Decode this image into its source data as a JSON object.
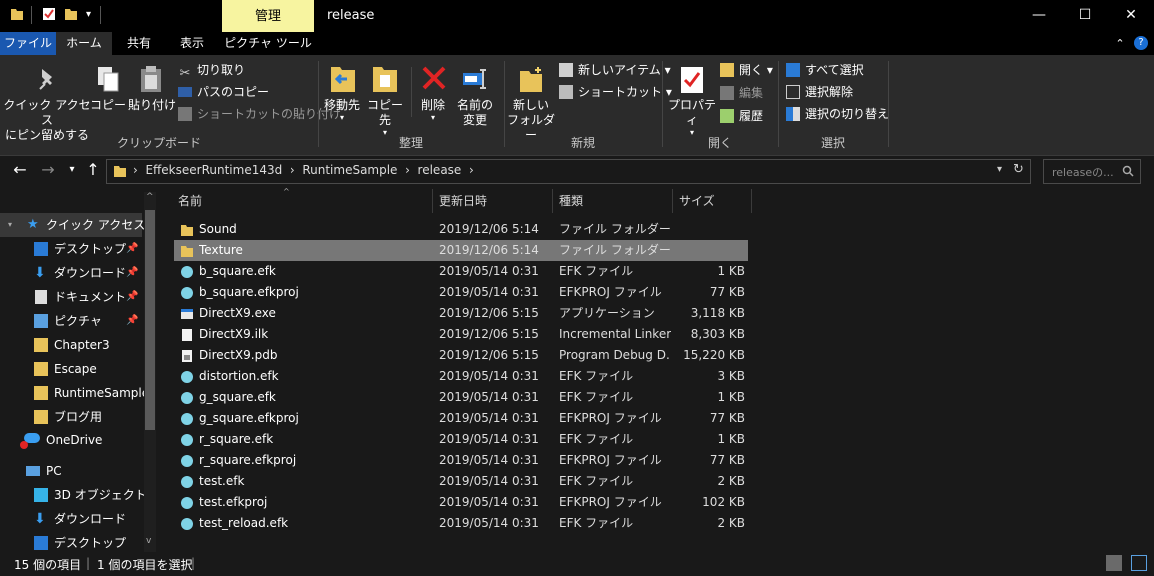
{
  "window": {
    "title": "release",
    "manage_tab": "管理",
    "minimize": "—",
    "maximize": "☐",
    "close": "✕"
  },
  "ribbon_tabs": {
    "file": "ファイル",
    "home": "ホーム",
    "share": "共有",
    "view": "表示",
    "picture_tools": "ピクチャ ツール",
    "collapse": "⌃",
    "help": "?"
  },
  "ribbon": {
    "clipboard": {
      "pin_quick_access": [
        "クイック アクセス",
        "にピン留めする"
      ],
      "copy": "コピー",
      "paste": "貼り付け",
      "cut": "切り取り",
      "copy_path": "パスのコピー",
      "paste_shortcut": "ショートカットの貼り付け",
      "group": "クリップボード"
    },
    "organize": {
      "move_to": "移動先",
      "copy_to": "コピー先",
      "delete": "削除",
      "rename": [
        "名前の",
        "変更"
      ],
      "group": "整理"
    },
    "new": {
      "new_folder": [
        "新しい",
        "フォルダー"
      ],
      "new_item": "新しいアイテム",
      "shortcut": "ショートカット",
      "group": "新規"
    },
    "open": {
      "properties": "プロパティ",
      "open": "開く",
      "edit": "編集",
      "history": "履歴",
      "group": "開く"
    },
    "select": {
      "select_all": "すべて選択",
      "select_none": "選択解除",
      "invert": "選択の切り替え",
      "group": "選択"
    }
  },
  "address": {
    "crumbs": [
      "EffekseerRuntime143d",
      "RuntimeSample",
      "release"
    ],
    "search_placeholder": "releaseの..."
  },
  "nav": {
    "quick_access": "クイック アクセス",
    "items": [
      "デスクトップ",
      "ダウンロード",
      "ドキュメント",
      "ピクチャ",
      "Chapter3",
      "Escape",
      "RuntimeSample",
      "ブログ用"
    ],
    "onedrive": "OneDrive",
    "pc": "PC",
    "pc_items": [
      "3D オブジェクト",
      "ダウンロード",
      "デスクトップ"
    ]
  },
  "columns": {
    "name": "名前",
    "date": "更新日時",
    "type": "種類",
    "size": "サイズ"
  },
  "files": [
    {
      "name": "Sound",
      "date": "2019/12/06 5:14",
      "type": "ファイル フォルダー",
      "size": "",
      "icon": "folder"
    },
    {
      "name": "Texture",
      "date": "2019/12/06 5:14",
      "type": "ファイル フォルダー",
      "size": "",
      "icon": "folder"
    },
    {
      "name": "b_square.efk",
      "date": "2019/05/14 0:31",
      "type": "EFK ファイル",
      "size": "1 KB",
      "icon": "efk"
    },
    {
      "name": "b_square.efkproj",
      "date": "2019/05/14 0:31",
      "type": "EFKPROJ ファイル",
      "size": "77 KB",
      "icon": "efk"
    },
    {
      "name": "DirectX9.exe",
      "date": "2019/12/06 5:15",
      "type": "アプリケーション",
      "size": "3,118 KB",
      "icon": "exe"
    },
    {
      "name": "DirectX9.ilk",
      "date": "2019/12/06 5:15",
      "type": "Incremental Linker...",
      "size": "8,303 KB",
      "icon": "doc"
    },
    {
      "name": "DirectX9.pdb",
      "date": "2019/12/06 5:15",
      "type": "Program Debug D...",
      "size": "15,220 KB",
      "icon": "pdb"
    },
    {
      "name": "distortion.efk",
      "date": "2019/05/14 0:31",
      "type": "EFK ファイル",
      "size": "3 KB",
      "icon": "efk"
    },
    {
      "name": "g_square.efk",
      "date": "2019/05/14 0:31",
      "type": "EFK ファイル",
      "size": "1 KB",
      "icon": "efk"
    },
    {
      "name": "g_square.efkproj",
      "date": "2019/05/14 0:31",
      "type": "EFKPROJ ファイル",
      "size": "77 KB",
      "icon": "efk"
    },
    {
      "name": "r_square.efk",
      "date": "2019/05/14 0:31",
      "type": "EFK ファイル",
      "size": "1 KB",
      "icon": "efk"
    },
    {
      "name": "r_square.efkproj",
      "date": "2019/05/14 0:31",
      "type": "EFKPROJ ファイル",
      "size": "77 KB",
      "icon": "efk"
    },
    {
      "name": "test.efk",
      "date": "2019/05/14 0:31",
      "type": "EFK ファイル",
      "size": "2 KB",
      "icon": "efk"
    },
    {
      "name": "test.efkproj",
      "date": "2019/05/14 0:31",
      "type": "EFKPROJ ファイル",
      "size": "102 KB",
      "icon": "efk"
    },
    {
      "name": "test_reload.efk",
      "date": "2019/05/14 0:31",
      "type": "EFK ファイル",
      "size": "2 KB",
      "icon": "efk"
    }
  ],
  "selected_row": 1,
  "status": {
    "count": "15 個の項目",
    "selected": "1 個の項目を選択"
  },
  "colors": {
    "accent": "#1a58b0",
    "folder": "#e8c35a",
    "efk": "#7fd3e6",
    "selection": "#777777",
    "manage_tab": "#f7f4a0"
  }
}
